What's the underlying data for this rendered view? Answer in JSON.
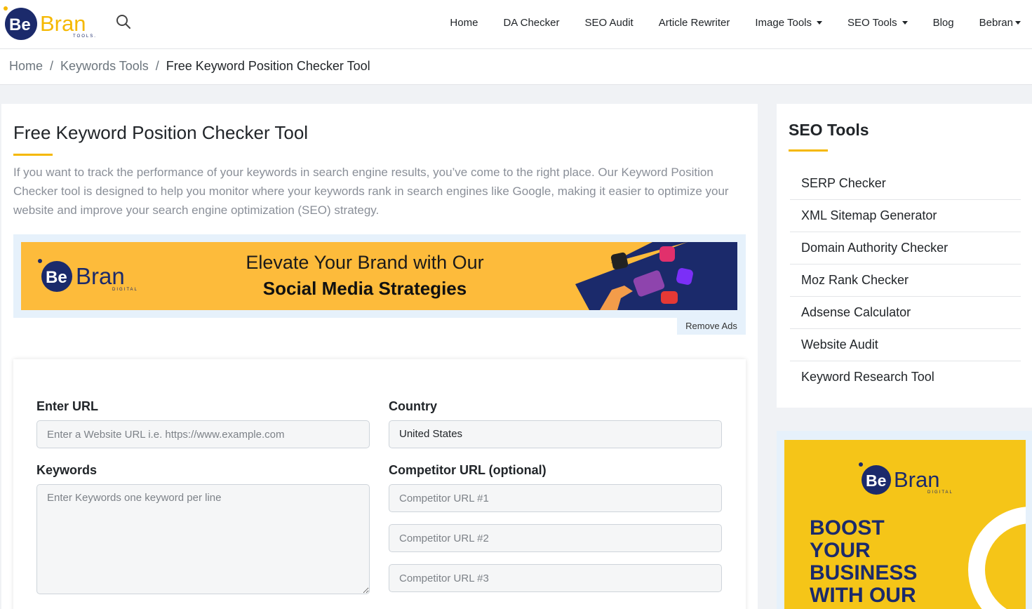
{
  "brand": {
    "logo_be": "Be",
    "logo_bran": "Bran",
    "logo_sub": "TOOLS.",
    "accent": "#f5b800",
    "navy": "#1b2a6b"
  },
  "nav": {
    "items": [
      {
        "label": "Home"
      },
      {
        "label": "DA Checker"
      },
      {
        "label": "SEO Audit"
      },
      {
        "label": "Article Rewriter"
      },
      {
        "label": "Image Tools"
      },
      {
        "label": "SEO Tools"
      },
      {
        "label": "Blog"
      },
      {
        "label": "Bebran"
      }
    ]
  },
  "breadcrumb": {
    "home": "Home",
    "section": "Keywords Tools",
    "current": "Free Keyword Position Checker Tool",
    "separator": "/"
  },
  "main": {
    "title": "Free Keyword Position Checker Tool",
    "intro": "If you want to track the performance of your keywords in search engine results, you’ve come to the right place. Our Keyword Position Checker tool is designed to help you monitor where your keywords rank in search engines like Google, making it easier to optimize your website and improve your search engine optimization (SEO) strategy."
  },
  "ad_banner": {
    "logo_be": "Be",
    "logo_bran": "Bran",
    "logo_sub": "DIGITAL",
    "line1": "Elevate Your Brand with Our",
    "line2": "Social Media Strategies",
    "remove_label": "Remove Ads"
  },
  "form": {
    "url_label": "Enter URL",
    "url_placeholder": "Enter a Website URL i.e. https://www.example.com",
    "country_label": "Country",
    "country_value": "United States",
    "keywords_label": "Keywords",
    "keywords_placeholder": "Enter Keywords one keyword per line",
    "competitor_label": "Competitor URL (optional)",
    "competitor_placeholders": [
      "Competitor URL #1",
      "Competitor URL #2",
      "Competitor URL #3"
    ]
  },
  "sidebar": {
    "title": "SEO Tools",
    "items": [
      {
        "label": "SERP Checker"
      },
      {
        "label": "XML Sitemap Generator"
      },
      {
        "label": "Domain Authority Checker"
      },
      {
        "label": "Moz Rank Checker"
      },
      {
        "label": "Adsense Calculator"
      },
      {
        "label": "Website Audit"
      },
      {
        "label": "Keyword Research Tool"
      }
    ]
  },
  "side_ad": {
    "logo_be": "Be",
    "logo_bran": "Bran",
    "logo_sub": "DIGITAL",
    "lines": [
      "BOOST",
      "YOUR",
      "BUSINESS",
      "WITH OUR"
    ]
  },
  "icons": {
    "search": "search-icon",
    "caret": "caret-down-icon"
  }
}
